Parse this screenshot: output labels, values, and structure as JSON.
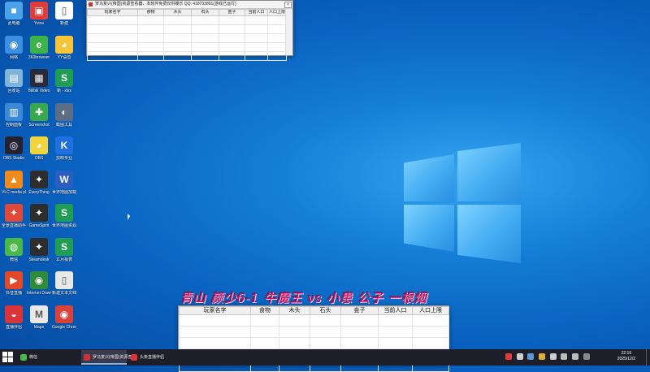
{
  "desktop": {
    "icons": [
      {
        "label": "此电脑",
        "glyph": "■",
        "color": "#4aa3e8",
        "col": 0,
        "row": 0
      },
      {
        "label": "Yvine",
        "glyph": "▣",
        "color": "#e23c3c",
        "col": 1,
        "row": 0
      },
      {
        "label": "新建",
        "glyph": "▯",
        "color": "#ffffff",
        "col": 2,
        "row": 0
      },
      {
        "label": "网络",
        "glyph": "◉",
        "color": "#3b8fe0",
        "col": 0,
        "row": 1
      },
      {
        "label": "360browser",
        "glyph": "e",
        "color": "#3db24b",
        "col": 1,
        "row": 1
      },
      {
        "label": "YY语音",
        "glyph": "◕",
        "color": "#f6c53a",
        "col": 2,
        "row": 1
      },
      {
        "label": "回收站",
        "glyph": "▤",
        "color": "#7fb3d9",
        "col": 0,
        "row": 2
      },
      {
        "label": "Bilibili Video",
        "glyph": "▦",
        "color": "#2a2a3a",
        "col": 1,
        "row": 2
      },
      {
        "label": "新 - xlsx",
        "glyph": "S",
        "color": "#1f9d55",
        "col": 2,
        "row": 2
      },
      {
        "label": "控制面板",
        "glyph": "▥",
        "color": "#3a88d6",
        "col": 0,
        "row": 3
      },
      {
        "label": "Screenshot",
        "glyph": "✚",
        "color": "#39a84a",
        "col": 1,
        "row": 3
      },
      {
        "label": "截图工具",
        "glyph": "◐",
        "color": "#5c6e86",
        "col": 2,
        "row": 3
      },
      {
        "label": "OBS Studio",
        "glyph": "◎",
        "color": "#222233",
        "col": 0,
        "row": 4
      },
      {
        "label": "OBS",
        "glyph": "◕",
        "color": "#f2d53c",
        "col": 1,
        "row": 4
      },
      {
        "label": "剪映专业",
        "glyph": "K",
        "color": "#1f6fe0",
        "col": 2,
        "row": 4
      },
      {
        "label": "VLC media player",
        "glyph": "▲",
        "color": "#f08a1c",
        "col": 0,
        "row": 5
      },
      {
        "label": "EveryThing",
        "glyph": "✦",
        "color": "#2d2d2d",
        "col": 1,
        "row": 5
      },
      {
        "label": "世界地图加载",
        "glyph": "W",
        "color": "#2b5fbf",
        "col": 2,
        "row": 5
      },
      {
        "label": "全景直播助手",
        "glyph": "✦",
        "color": "#e0493a",
        "col": 0,
        "row": 6
      },
      {
        "label": "GameSpirit",
        "glyph": "✦",
        "color": "#2d2d2d",
        "col": 1,
        "row": 6
      },
      {
        "label": "世界地图资源统计",
        "glyph": "S",
        "color": "#1f9d55",
        "col": 2,
        "row": 6
      },
      {
        "label": "微信",
        "glyph": "◍",
        "color": "#4ab848",
        "col": 0,
        "row": 7
      },
      {
        "label": "Steamdesk",
        "glyph": "✦",
        "color": "#2d2d2d",
        "col": 1,
        "row": 7
      },
      {
        "label": "11月报表",
        "glyph": "S",
        "color": "#1f9d55",
        "col": 2,
        "row": 7
      },
      {
        "label": "抖音直播",
        "glyph": "▶",
        "color": "#e04a2a",
        "col": 0,
        "row": 8
      },
      {
        "label": "Internet Download",
        "glyph": "◉",
        "color": "#2f8a3a",
        "col": 1,
        "row": 8
      },
      {
        "label": "新建文本文档",
        "glyph": "▯",
        "color": "#e8e8e8",
        "col": 2,
        "row": 8
      },
      {
        "label": "直播伴侣",
        "glyph": "◒",
        "color": "#d8343a",
        "col": 0,
        "row": 9
      },
      {
        "label": "Maps",
        "glyph": "M",
        "color": "#e8e8e8",
        "col": 1,
        "row": 9
      },
      {
        "label": "Google Chrome",
        "glyph": "◉",
        "color": "#d9423a",
        "col": 2,
        "row": 9
      }
    ]
  },
  "small_window": {
    "title": "罗马复兴(帝国)资源查看器，本软件免费仅供娱乐 QQ: 418733891(游戏已运行)",
    "close": "×",
    "columns": [
      "玩家名字",
      "食物",
      "木头",
      "石头",
      "金子",
      "当前人口",
      "人口上限"
    ]
  },
  "large_window": {
    "columns": [
      "玩家名字",
      "食物",
      "木头",
      "石头",
      "金子",
      "当前人口",
      "人口上限"
    ]
  },
  "banner": {
    "text": "青山 颜少6-1 牛魔王 vs 小患 公子 一根烟"
  },
  "taskbar": {
    "items": [
      {
        "label": "微信",
        "color": "#4ab848",
        "active": false
      },
      {
        "label": "罗马复兴(帝国)资源查...",
        "color": "#c8323a",
        "active": true
      },
      {
        "label": "头条直播伴侣",
        "color": "#d8343a",
        "active": false
      }
    ],
    "time": "22:16",
    "date": "2025/12/2"
  }
}
